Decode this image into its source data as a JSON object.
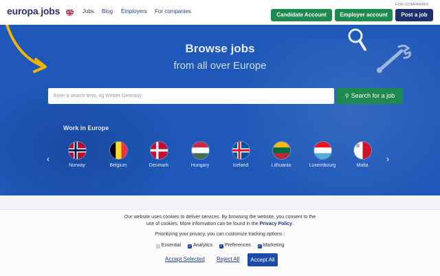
{
  "header": {
    "logo_part1": "europa",
    "logo_part2": ".",
    "logo_part3": "jobs",
    "nav": [
      "Jobs",
      "Blog",
      "Employers",
      "For companies"
    ],
    "for_companies_label": "FOR COMPANIES",
    "buttons": {
      "candidate": "Candidate Account",
      "employer": "Employer account",
      "post": "Post a job"
    },
    "colors": {
      "green": "#1f8a4f",
      "navy": "#1c2f6e"
    }
  },
  "hero": {
    "title": "Browse jobs",
    "subtitle": "from all over Europe",
    "search_placeholder": "Enter a search term, eg Welder Germany",
    "search_button": "Search for a job",
    "work_title": "Work in Europe",
    "countries": [
      "Norway",
      "Belgium",
      "Denmark",
      "Hungary",
      "Iceland",
      "Lithuania",
      "Luxembourg",
      "Malta"
    ],
    "color_bg": "#1f58b8"
  },
  "cookie": {
    "text_line1": "Our website uses cookies to deliver services. By browsing the website, you consent to the",
    "text_line2": "use of cookies.  More information can be found in the",
    "privacy_link": "Privacy Policy",
    "text_end": ".",
    "subtitle": "Prioritizing your privacy, you can customize tracking options :",
    "options": [
      {
        "label": "Essential",
        "checked": false
      },
      {
        "label": "Analytics",
        "checked": true
      },
      {
        "label": "Preferences",
        "checked": true
      },
      {
        "label": "Marketing",
        "checked": true
      }
    ],
    "accept_selected": "Accept Selected",
    "reject_all": "Reject All",
    "accept_all": "Accept All"
  }
}
